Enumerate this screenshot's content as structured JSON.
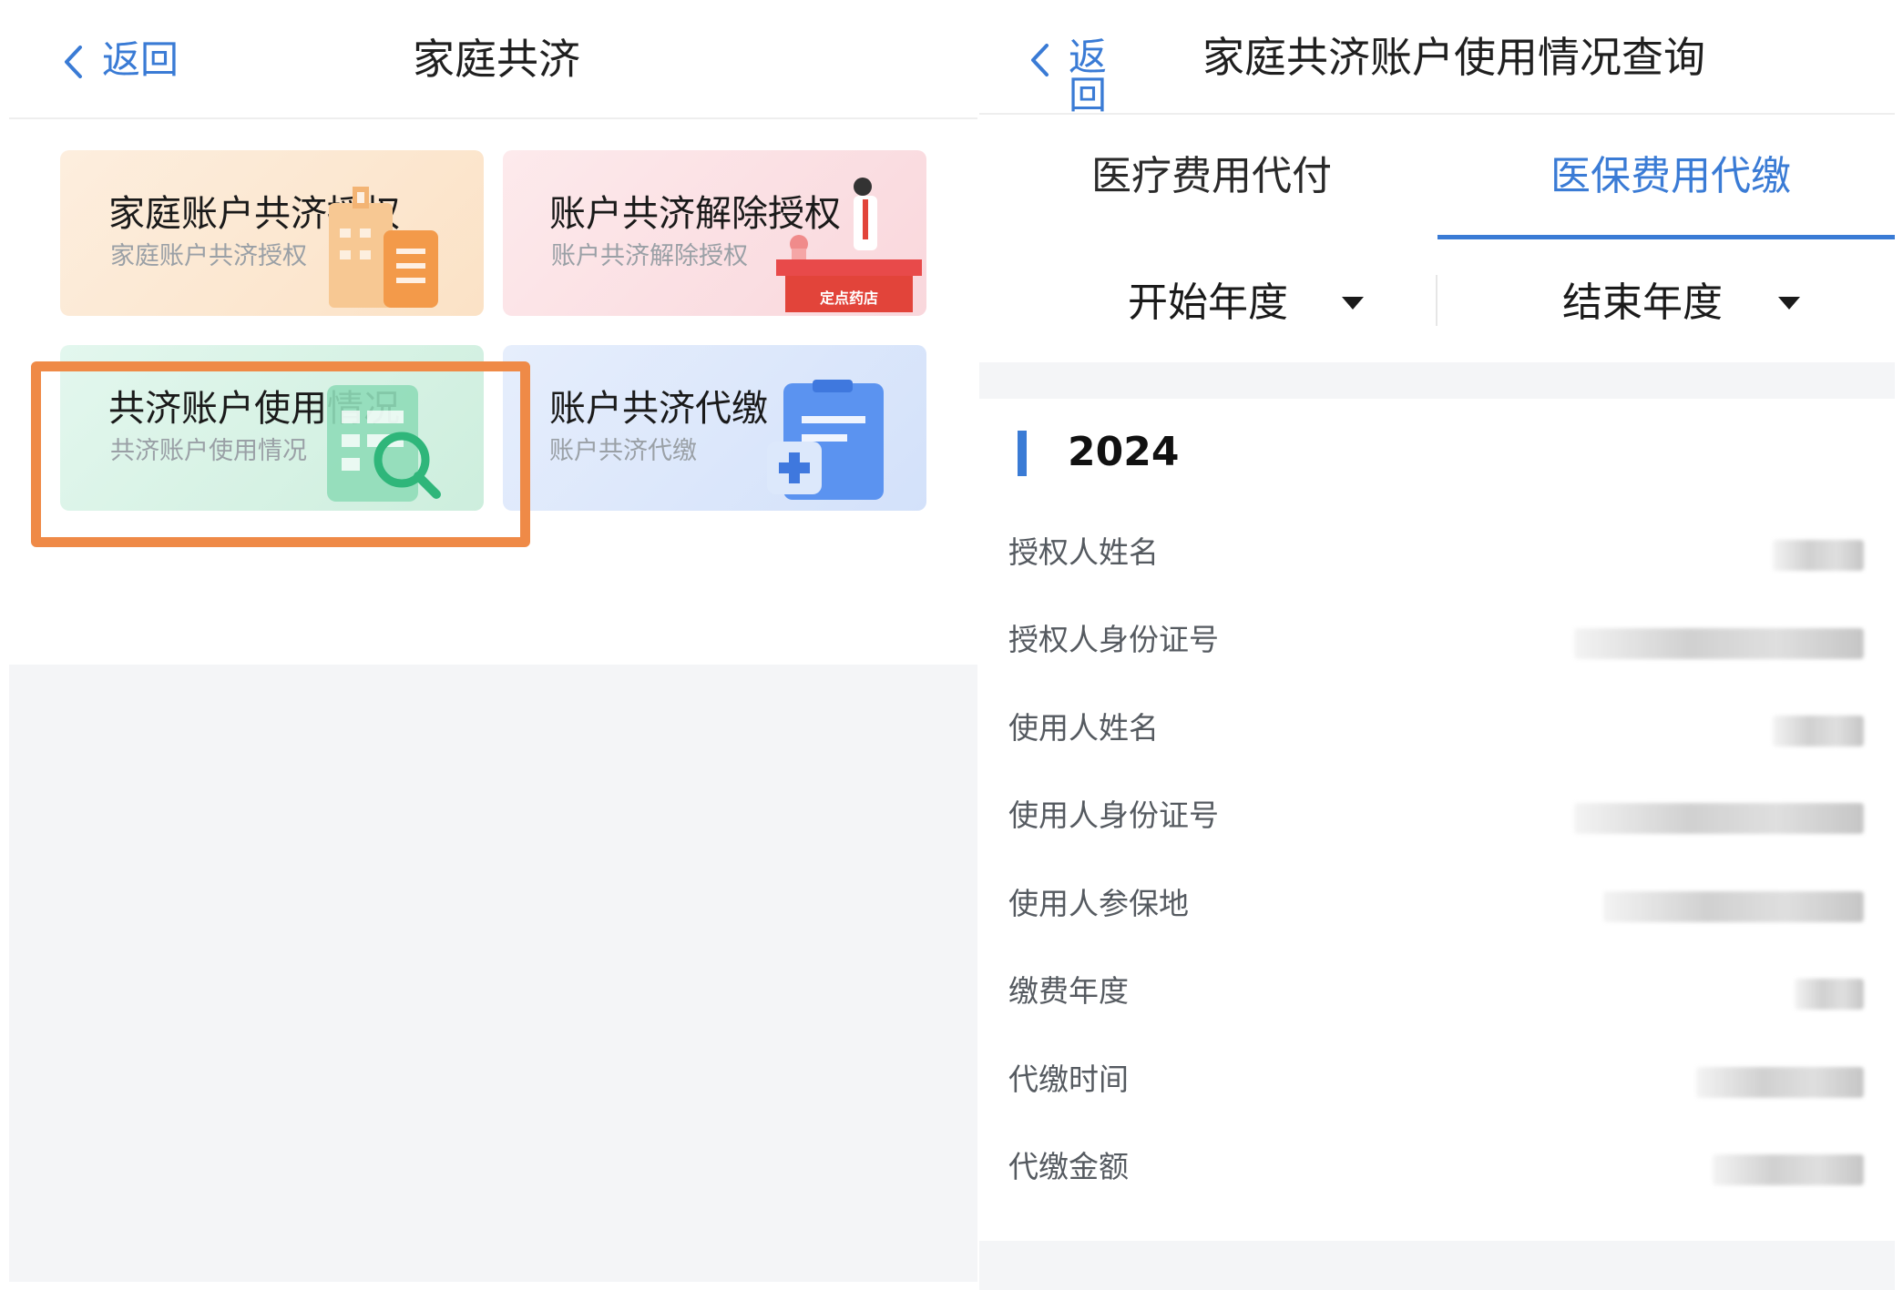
{
  "left": {
    "back_label": "返回",
    "title": "家庭共济",
    "cards": [
      {
        "title": "家庭账户共济授权",
        "subtitle": "家庭账户共济授权",
        "icon": "building-icon"
      },
      {
        "title": "账户共济解除授权",
        "subtitle": "账户共济解除授权",
        "icon": "pharmacy-icon",
        "badge": "定点药店"
      },
      {
        "title": "共济账户使用情况",
        "subtitle": "共济账户使用情况",
        "icon": "search-document-icon",
        "highlighted": true
      },
      {
        "title": "账户共济代缴",
        "subtitle": "账户共济代缴",
        "icon": "medical-clipboard-icon"
      }
    ],
    "highlight_color": "#ef8a47"
  },
  "right": {
    "back_label": "返回",
    "title": "家庭共济账户使用情况查询",
    "tabs": [
      {
        "label": "医疗费用代付",
        "active": false
      },
      {
        "label": "医保费用代缴",
        "active": true
      }
    ],
    "filters": {
      "start": "开始年度",
      "end": "结束年度"
    },
    "year": "2024",
    "fields": [
      {
        "label": "授权人姓名"
      },
      {
        "label": "授权人身份证号"
      },
      {
        "label": "使用人姓名"
      },
      {
        "label": "使用人身份证号"
      },
      {
        "label": "使用人参保地"
      },
      {
        "label": "缴费年度"
      },
      {
        "label": "代缴时间"
      },
      {
        "label": "代缴金额"
      }
    ]
  },
  "colors": {
    "accent": "#3a7bd5",
    "highlight": "#ef8a47"
  }
}
